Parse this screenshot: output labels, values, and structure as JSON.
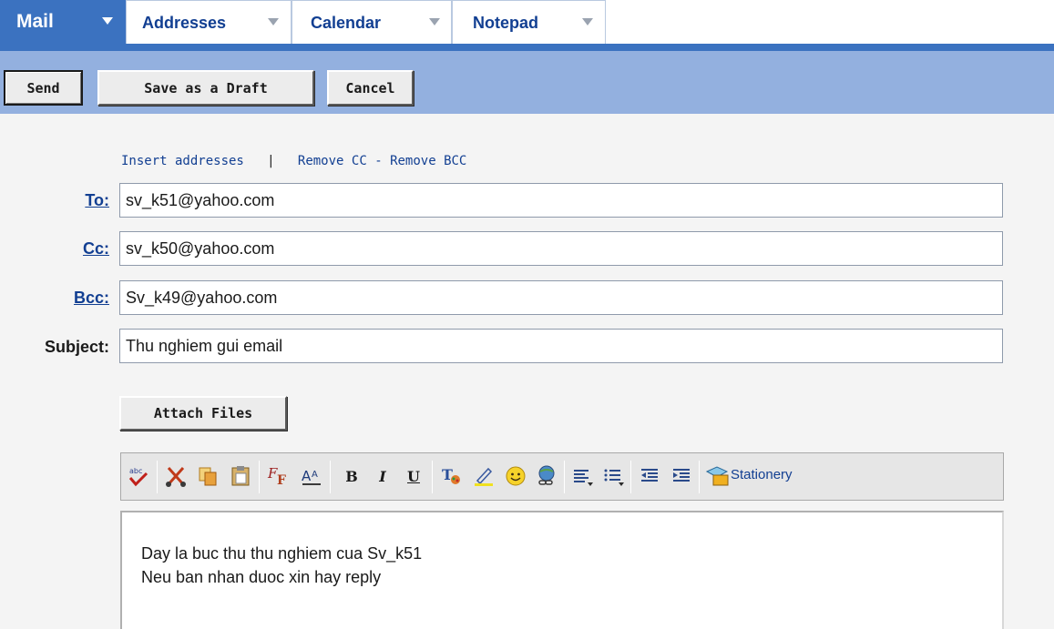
{
  "tabs": [
    {
      "label": "Mail",
      "active": true
    },
    {
      "label": "Addresses",
      "active": false
    },
    {
      "label": "Calendar",
      "active": false
    },
    {
      "label": "Notepad",
      "active": false
    }
  ],
  "toolbar": {
    "send_label": "Send",
    "draft_label": "Save as a Draft",
    "cancel_label": "Cancel"
  },
  "compose": {
    "insert_addresses": "Insert addresses",
    "divider": "|",
    "remove_cc": "Remove CC",
    "dash": "-",
    "remove_bcc": "Remove BCC",
    "to_label": "To:",
    "to_value": "sv_k51@yahoo.com",
    "cc_label": "Cc:",
    "cc_value": "sv_k50@yahoo.com",
    "bcc_label": "Bcc:",
    "bcc_value": "Sv_k49@yahoo.com",
    "subject_label": "Subject:",
    "subject_value": "Thu nghiem gui email",
    "attach_label": "Attach Files"
  },
  "editor": {
    "icons": [
      "spellcheck-icon",
      "cut-icon",
      "copy-icon",
      "paste-icon",
      "font-icon",
      "font-size-icon",
      "bold-icon",
      "italic-icon",
      "underline-icon",
      "text-color-icon",
      "highlight-icon",
      "emoticon-icon",
      "link-icon",
      "align-icon",
      "bullet-list-icon",
      "outdent-icon",
      "indent-icon",
      "stationery-icon"
    ],
    "bold_glyph": "B",
    "italic_glyph": "I",
    "underline_glyph": "U",
    "stationery_label": "Stationery",
    "body_lines": [
      "Day la buc thu thu nghiem cua Sv_k51",
      "Neu ban nhan duoc xin hay reply"
    ]
  },
  "colors": {
    "accent": "#3b72c0",
    "toolbar_bg": "#93b0df",
    "link": "#123f92"
  }
}
